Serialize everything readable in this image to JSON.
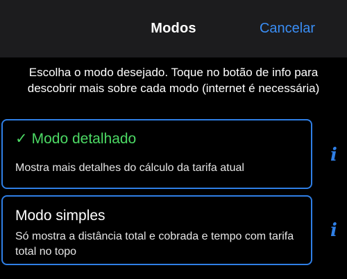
{
  "nav": {
    "title": "Modos",
    "cancel_label": "Cancelar"
  },
  "instructions": "Escolha o modo desejado. Toque no botão de info para descobrir mais sobre cada modo (internet é necessária)",
  "modes": [
    {
      "check": "✓",
      "title": "Modo detalhado",
      "description": "Mostra mais detalhes do cálculo da tarifa atual",
      "selected": true,
      "info_glyph": "i"
    },
    {
      "title": "Modo simples",
      "description": "Só mostra a distância total e cobrada e tempo com tarifa total no topo",
      "selected": false,
      "info_glyph": "i"
    }
  ],
  "colors": {
    "accent": "#3a8ef6",
    "selected": "#4cd964",
    "nav_background": "#1c1c1e",
    "background": "#000000"
  }
}
